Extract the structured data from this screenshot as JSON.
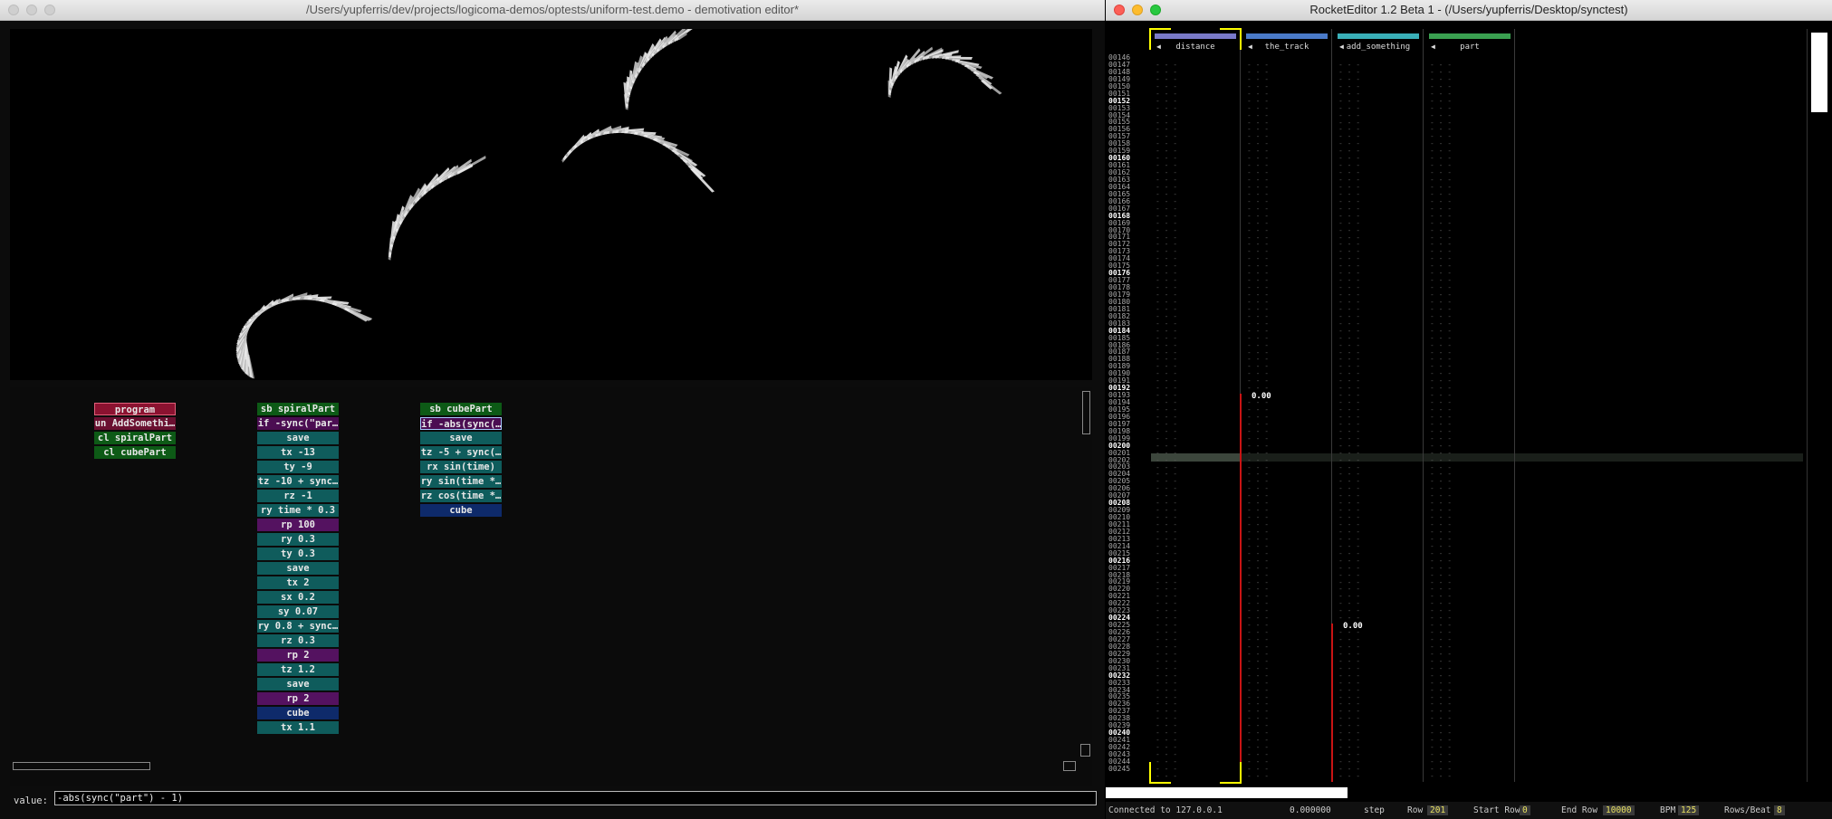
{
  "left_window": {
    "title": "/Users/yupferris/dev/projects/logicoma-demos/optests/uniform-test.demo - demotivation editor*",
    "value_label": "value:",
    "value_text": "-abs(sync(\"part\") - 1)"
  },
  "graph": {
    "col1": [
      {
        "label": "program",
        "kind": "program"
      },
      {
        "label": "un AddSomethi…",
        "kind": "un"
      },
      {
        "label": "cl spiralPart",
        "kind": "cl"
      },
      {
        "label": "cl cubePart",
        "kind": "cl"
      }
    ],
    "col2": [
      {
        "label": "sb spiralPart",
        "kind": "sb"
      },
      {
        "label": "if -sync(\"par…",
        "kind": "if"
      },
      {
        "label": "save",
        "kind": "op"
      },
      {
        "label": "tx -13",
        "kind": "op"
      },
      {
        "label": "ty -9",
        "kind": "op"
      },
      {
        "label": "tz -10 + sync…",
        "kind": "op"
      },
      {
        "label": "rz -1",
        "kind": "op"
      },
      {
        "label": "ry time * 0.3",
        "kind": "op"
      },
      {
        "label": "rp 100",
        "kind": "rp"
      },
      {
        "label": "ry 0.3",
        "kind": "op"
      },
      {
        "label": "ty 0.3",
        "kind": "op"
      },
      {
        "label": "save",
        "kind": "op"
      },
      {
        "label": "tx 2",
        "kind": "op"
      },
      {
        "label": "sx 0.2",
        "kind": "op"
      },
      {
        "label": "sy 0.07",
        "kind": "op"
      },
      {
        "label": "ry 0.8 + sync…",
        "kind": "op"
      },
      {
        "label": "rz 0.3",
        "kind": "op"
      },
      {
        "label": "rp 2",
        "kind": "rp"
      },
      {
        "label": "tz 1.2",
        "kind": "op"
      },
      {
        "label": "save",
        "kind": "op"
      },
      {
        "label": "rp 2",
        "kind": "rp"
      },
      {
        "label": "cube",
        "kind": "cube"
      },
      {
        "label": "tx 1.1",
        "kind": "op"
      }
    ],
    "col3": [
      {
        "label": "sb cubePart",
        "kind": "sb"
      },
      {
        "label": "if -abs(sync(…",
        "kind": "sel"
      },
      {
        "label": "save",
        "kind": "op"
      },
      {
        "label": "tz -5 + sync(…",
        "kind": "op"
      },
      {
        "label": "rx sin(time)",
        "kind": "op"
      },
      {
        "label": "ry sin(time *…",
        "kind": "op"
      },
      {
        "label": "rz cos(time *…",
        "kind": "op"
      },
      {
        "label": "cube",
        "kind": "cube"
      }
    ]
  },
  "right_window": {
    "title": "RocketEditor 1.2 Beta 1 - (/Users/yupferris/Desktop/synctest)",
    "row_start": 146,
    "row_end": 245,
    "tracks": [
      {
        "name": "distance",
        "color": "#7a7ac8",
        "value": "",
        "value_row": null
      },
      {
        "name": "the_track",
        "color": "#4a7ac8",
        "value": "0.00",
        "value_row": 192
      },
      {
        "name": "add_something",
        "color": "#3ab0b8",
        "value": "0.00",
        "value_row": 224
      },
      {
        "name": "part",
        "color": "#3aa050",
        "value": "",
        "value_row": null
      }
    ],
    "status": {
      "connected": "Connected to 127.0.0.1",
      "time": "0.000000",
      "step_label": "step",
      "row_label": "Row",
      "row_value": "201",
      "start_row_label": "Start Row",
      "start_row_value": "0",
      "end_row_label": "End Row",
      "end_row_value": "10000",
      "bpm_label": "BPM",
      "bpm_value": "125",
      "rpb_label": "Rows/Beat",
      "rpb_value": "8"
    }
  },
  "colors": {
    "selection": "#ffff00",
    "interpolation_line": "#c81414"
  }
}
